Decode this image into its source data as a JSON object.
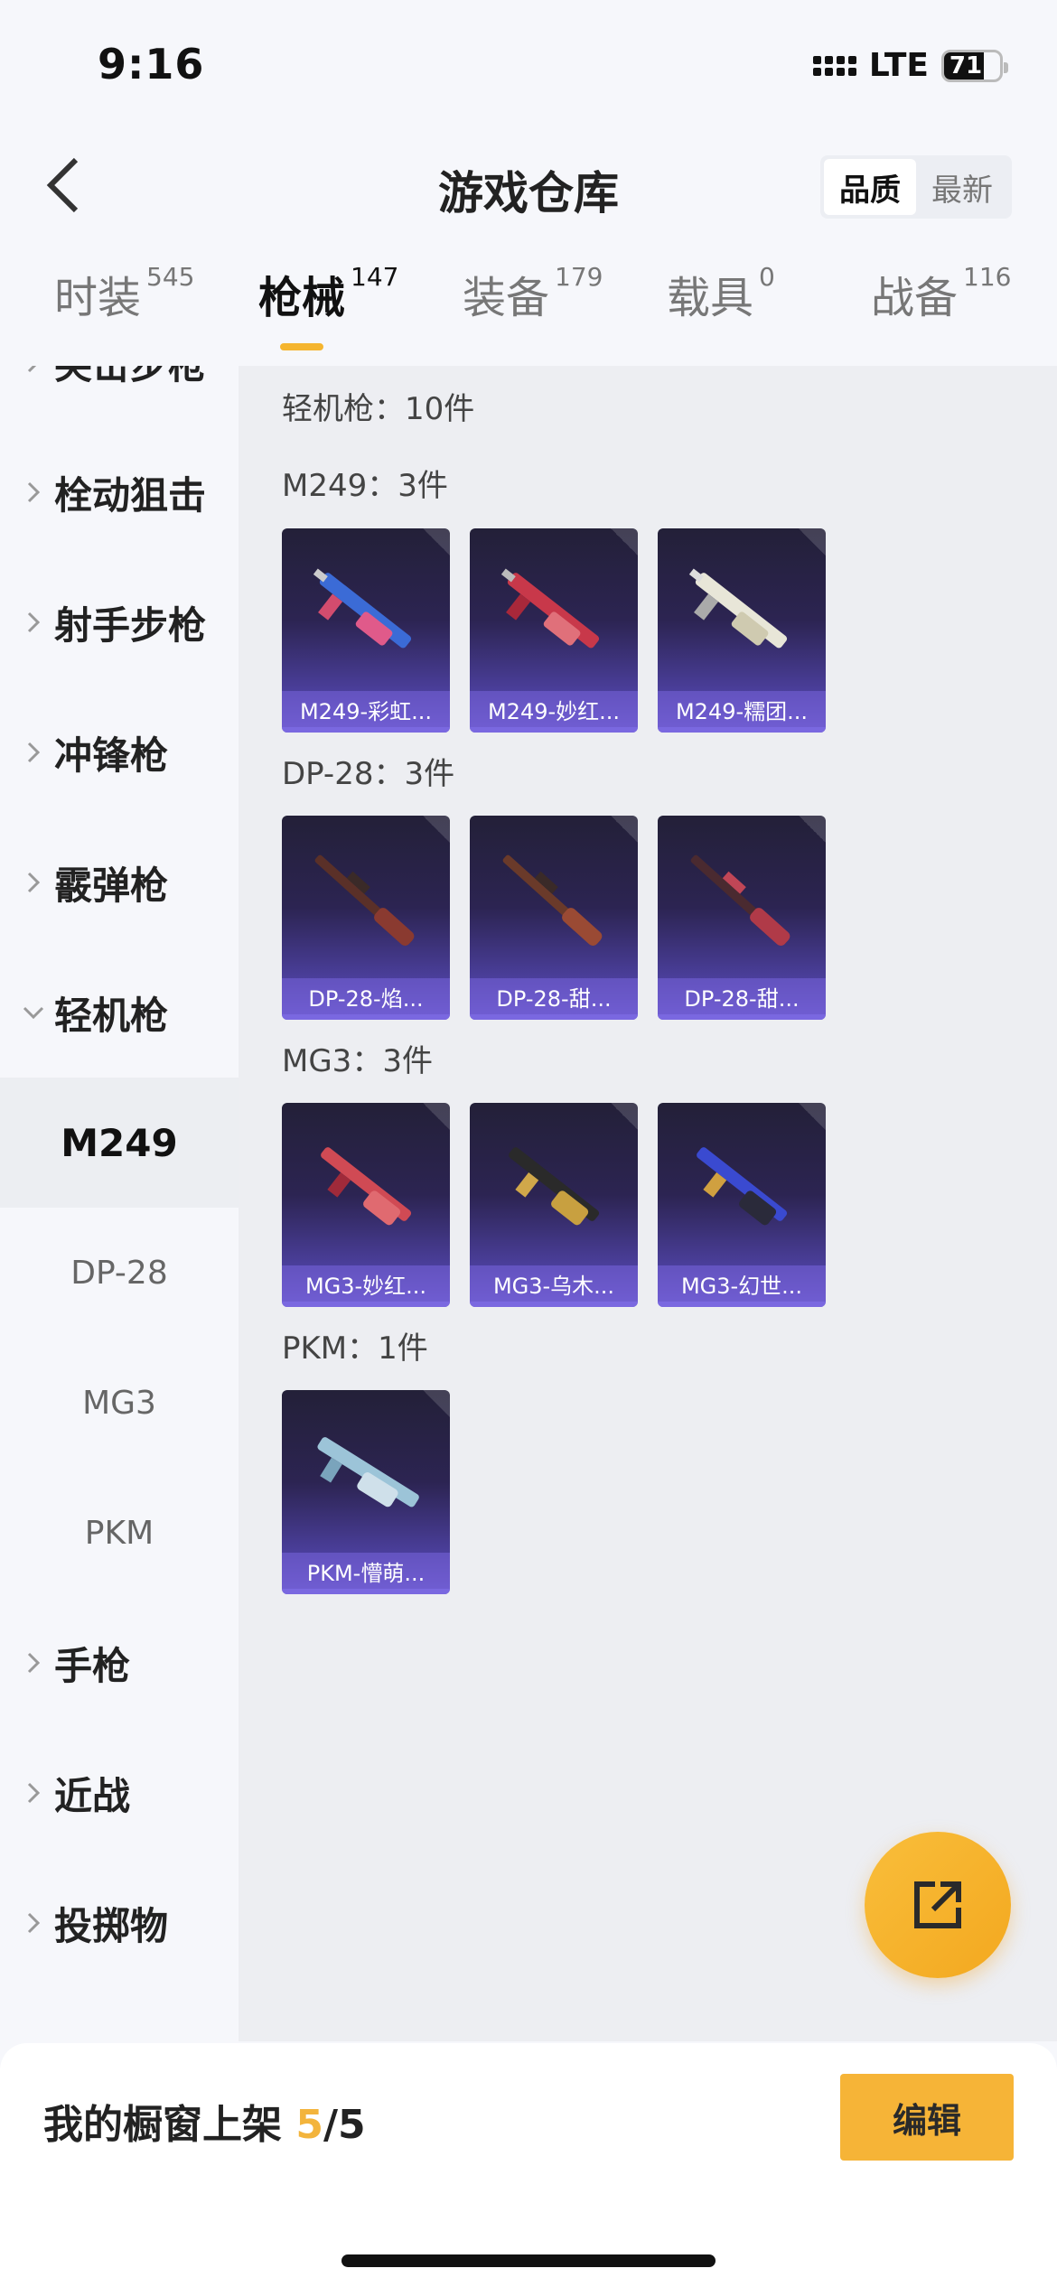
{
  "status": {
    "time": "9:16",
    "network": "LTE",
    "battery": "71",
    "battery_level": 0.71
  },
  "header": {
    "title": "游戏仓库",
    "sort_quality": "品质",
    "sort_newest": "最新"
  },
  "tabs": [
    {
      "label": "时装",
      "count": "545"
    },
    {
      "label": "枪械",
      "count": "147"
    },
    {
      "label": "装备",
      "count": "179"
    },
    {
      "label": "载具",
      "count": "0"
    },
    {
      "label": "战备",
      "count": "116"
    }
  ],
  "sidebar": {
    "items": [
      {
        "label": "突击步枪"
      },
      {
        "label": "栓动狙击"
      },
      {
        "label": "射手步枪"
      },
      {
        "label": "冲锋枪"
      },
      {
        "label": "霰弹枪"
      },
      {
        "label": "轻机枪"
      }
    ],
    "subitems": [
      "M249",
      "DP-28",
      "MG3",
      "PKM"
    ],
    "items_after": [
      {
        "label": "手枪"
      },
      {
        "label": "近战"
      },
      {
        "label": "投掷物"
      }
    ]
  },
  "content": {
    "category_title": "轻机枪：10件",
    "groups": [
      {
        "title": "M249：3件",
        "items": [
          "M249-彩虹...",
          "M249-妙红...",
          "M249-糯团..."
        ]
      },
      {
        "title": "DP-28：3件",
        "items": [
          "DP-28-焰...",
          "DP-28-甜...",
          "DP-28-甜..."
        ]
      },
      {
        "title": "MG3：3件",
        "items": [
          "MG3-妙红...",
          "MG3-乌木...",
          "MG3-幻世..."
        ]
      },
      {
        "title": "PKM：1件",
        "items": [
          "PKM-懵萌..."
        ]
      }
    ]
  },
  "bottom": {
    "shelf_label": "我的橱窗上架",
    "shelf_current": "5",
    "shelf_total": "/5",
    "edit_label": "编辑"
  },
  "colors": {
    "accent": "#f6b437",
    "card_top": "#232038",
    "card_bottom": "#6957c9"
  }
}
